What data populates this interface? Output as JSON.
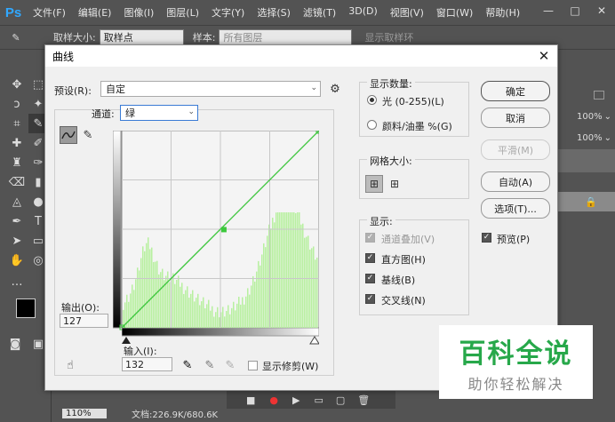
{
  "app": {
    "logo": "Ps"
  },
  "menubar": {
    "items": [
      "文件(F)",
      "编辑(E)",
      "图像(I)",
      "图层(L)",
      "文字(Y)",
      "选择(S)",
      "滤镜(T)",
      "3D(D)",
      "视图(V)",
      "窗口(W)",
      "帮助(H)"
    ]
  },
  "window_controls": {
    "minimize": "—",
    "maximize": "□",
    "close": "✕"
  },
  "options_bar": {
    "sample_size_label": "取样大小:",
    "sample_size_value": "取样点",
    "sample_label": "样本:",
    "sample_value": "所有图层",
    "show_ring_label": "显示取样环"
  },
  "right_panel": {
    "zoom1": "100%",
    "zoom2": "100%"
  },
  "status_bar": {
    "zoom": "110%",
    "doc": "文档:226.9K/680.6K"
  },
  "dialog": {
    "title": "曲线",
    "close": "✕",
    "preset_label": "预设(R):",
    "preset_value": "自定",
    "channel_label": "通道:",
    "channel_value": "绿",
    "output_label": "输出(O):",
    "output_value": "127",
    "input_label": "输入(I):",
    "input_value": "132",
    "show_clipping_label": "显示修剪(W)",
    "display_amount": {
      "title": "显示数量:",
      "light": "光 (0-255)(L)",
      "pigment": "颜料/油墨 %(G)",
      "selected": "light"
    },
    "grid_size": {
      "title": "网格大小:"
    },
    "display": {
      "title": "显示:",
      "options": [
        {
          "label": "通道叠加(V)",
          "checked": true,
          "disabled": true
        },
        {
          "label": "直方图(H)",
          "checked": true,
          "disabled": false
        },
        {
          "label": "基线(B)",
          "checked": true,
          "disabled": false
        },
        {
          "label": "交叉线(N)",
          "checked": true,
          "disabled": false
        }
      ]
    },
    "buttons": {
      "ok": "确定",
      "cancel": "取消",
      "smooth": "平滑(M)",
      "auto": "自动(A)",
      "options": "选项(T)..."
    },
    "preview_label": "预览(P)",
    "curve_color": "#3cc83c",
    "histogram_color": "#b8f0a0"
  },
  "watermark": {
    "title": "百科全说",
    "subtitle": "助你轻松解决"
  }
}
